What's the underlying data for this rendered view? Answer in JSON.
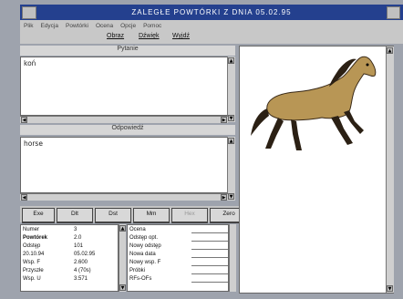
{
  "window": {
    "title": "ZALEGŁE POWTÓRKI Z DNIA 05.02.95"
  },
  "menu_top": {
    "items": [
      "Plik",
      "Edycja",
      "Powtórki",
      "Ocena",
      "Opcje",
      "Pomoc"
    ]
  },
  "menu_second": {
    "items": [
      {
        "label": "Obraz"
      },
      {
        "label": "Dźwięk"
      },
      {
        "label": "Wyjdź"
      }
    ]
  },
  "question": {
    "label": "Pytanie",
    "text": "koń"
  },
  "answer": {
    "label": "Odpowiedź",
    "text": "horse"
  },
  "buttons": [
    {
      "label": "Exe",
      "enabled": true
    },
    {
      "label": "Dlt",
      "enabled": true
    },
    {
      "label": "Dst",
      "enabled": true
    },
    {
      "label": "Mm",
      "enabled": true
    },
    {
      "label": "Hex",
      "enabled": false
    },
    {
      "label": "Zero",
      "enabled": true
    }
  ],
  "stats": [
    {
      "label": "Numer",
      "value": "3"
    },
    {
      "label": "Powtórek",
      "value": "2.0"
    },
    {
      "label": "Odstęp",
      "value": "101"
    },
    {
      "label": "20.10.94",
      "value": "05.02.95"
    },
    {
      "label": "Wsp. F",
      "value": "2.600"
    },
    {
      "label": "Przyszłe",
      "value": "4 (70s)"
    },
    {
      "label": "Wsp. U",
      "value": "3.571"
    }
  ],
  "rating": [
    {
      "label": "Ocena"
    },
    {
      "label": "Odstęp opt."
    },
    {
      "label": "Nowy odstęp"
    },
    {
      "label": "Nowa data"
    },
    {
      "label": "Nowy wsp. F"
    },
    {
      "label": "Próbki"
    },
    {
      "label": "RFs-OFs"
    }
  ],
  "image": {
    "subject": "horse-illustration"
  }
}
